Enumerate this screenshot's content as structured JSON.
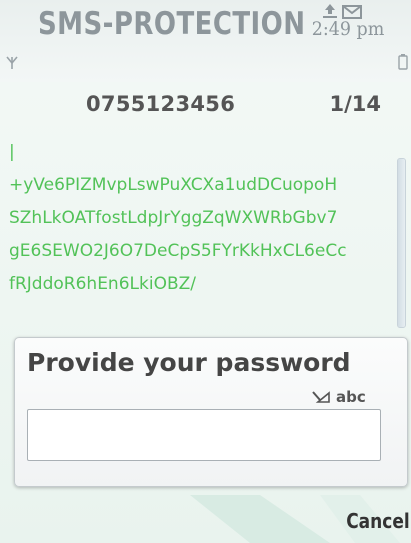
{
  "status": {
    "app_title": "SMS-PROTECTION",
    "time": "2:49 pm"
  },
  "message": {
    "sender": "0755123456",
    "counter": "1/14",
    "body": "|\n+yVe6PIZMvpLswPuXCXa1udDCuopoH\nSZhLkOATfostLdpJrYggZqWXWRbGbv7\ngE6SEWO2J6O7DeCpS5FYrKkHxCL6eCc\nfRJddoR6hEn6LkiOBZ/"
  },
  "dialog": {
    "title": "Provide your password",
    "input_mode": "abc",
    "password_value": ""
  },
  "softkeys": {
    "right_label": "Cancel"
  },
  "colors": {
    "message_text": "#52c258",
    "title_gray": "#8d969b"
  }
}
